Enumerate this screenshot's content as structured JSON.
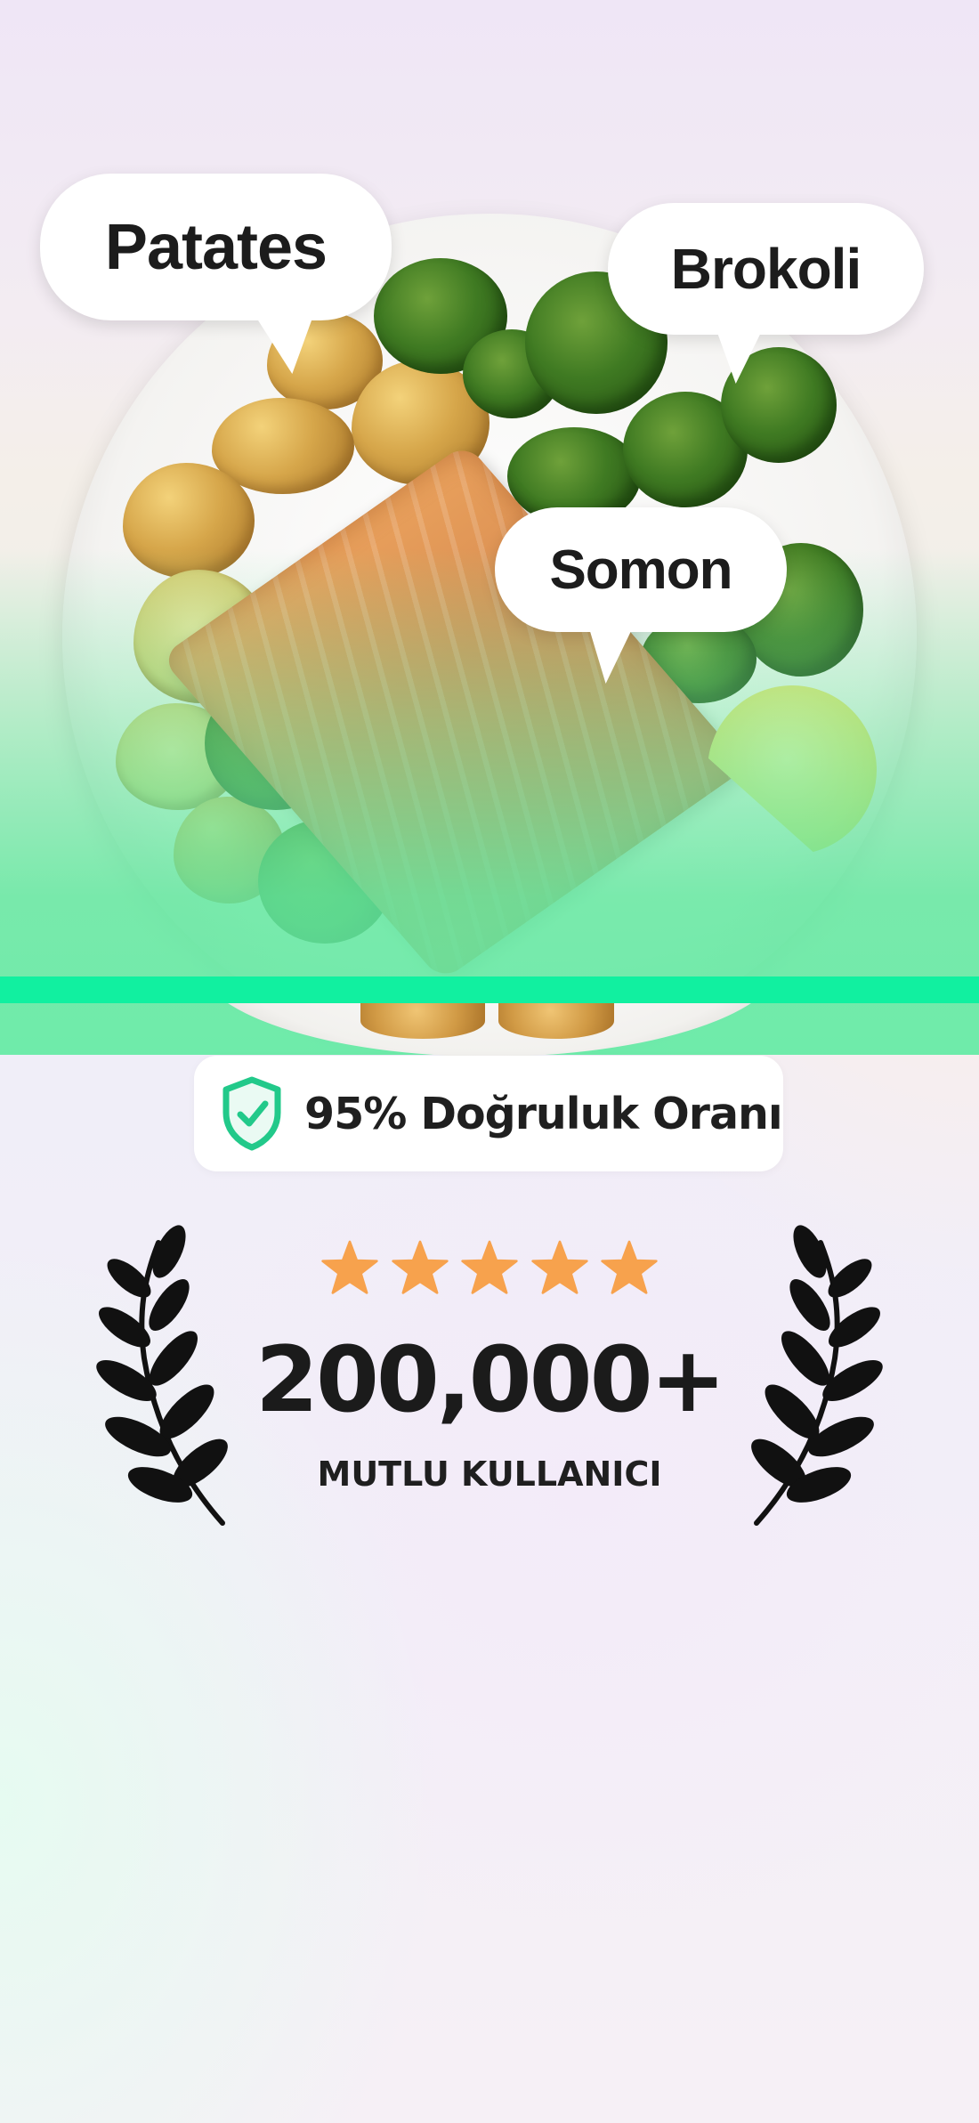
{
  "food_labels": {
    "potato": "Patates",
    "broccoli": "Brokoli",
    "salmon": "Somon"
  },
  "accuracy": {
    "text": "95% Doğruluk Oranı",
    "icon": "shield-check-icon",
    "icon_color": "#22c98a"
  },
  "rating": {
    "stars": 5,
    "star_color": "#f7a24d",
    "count": "200,000+",
    "label": "MUTLU KULLANICI"
  },
  "colors": {
    "scan_line": "#11f0a0",
    "scan_tint": "#6ee8a0"
  }
}
